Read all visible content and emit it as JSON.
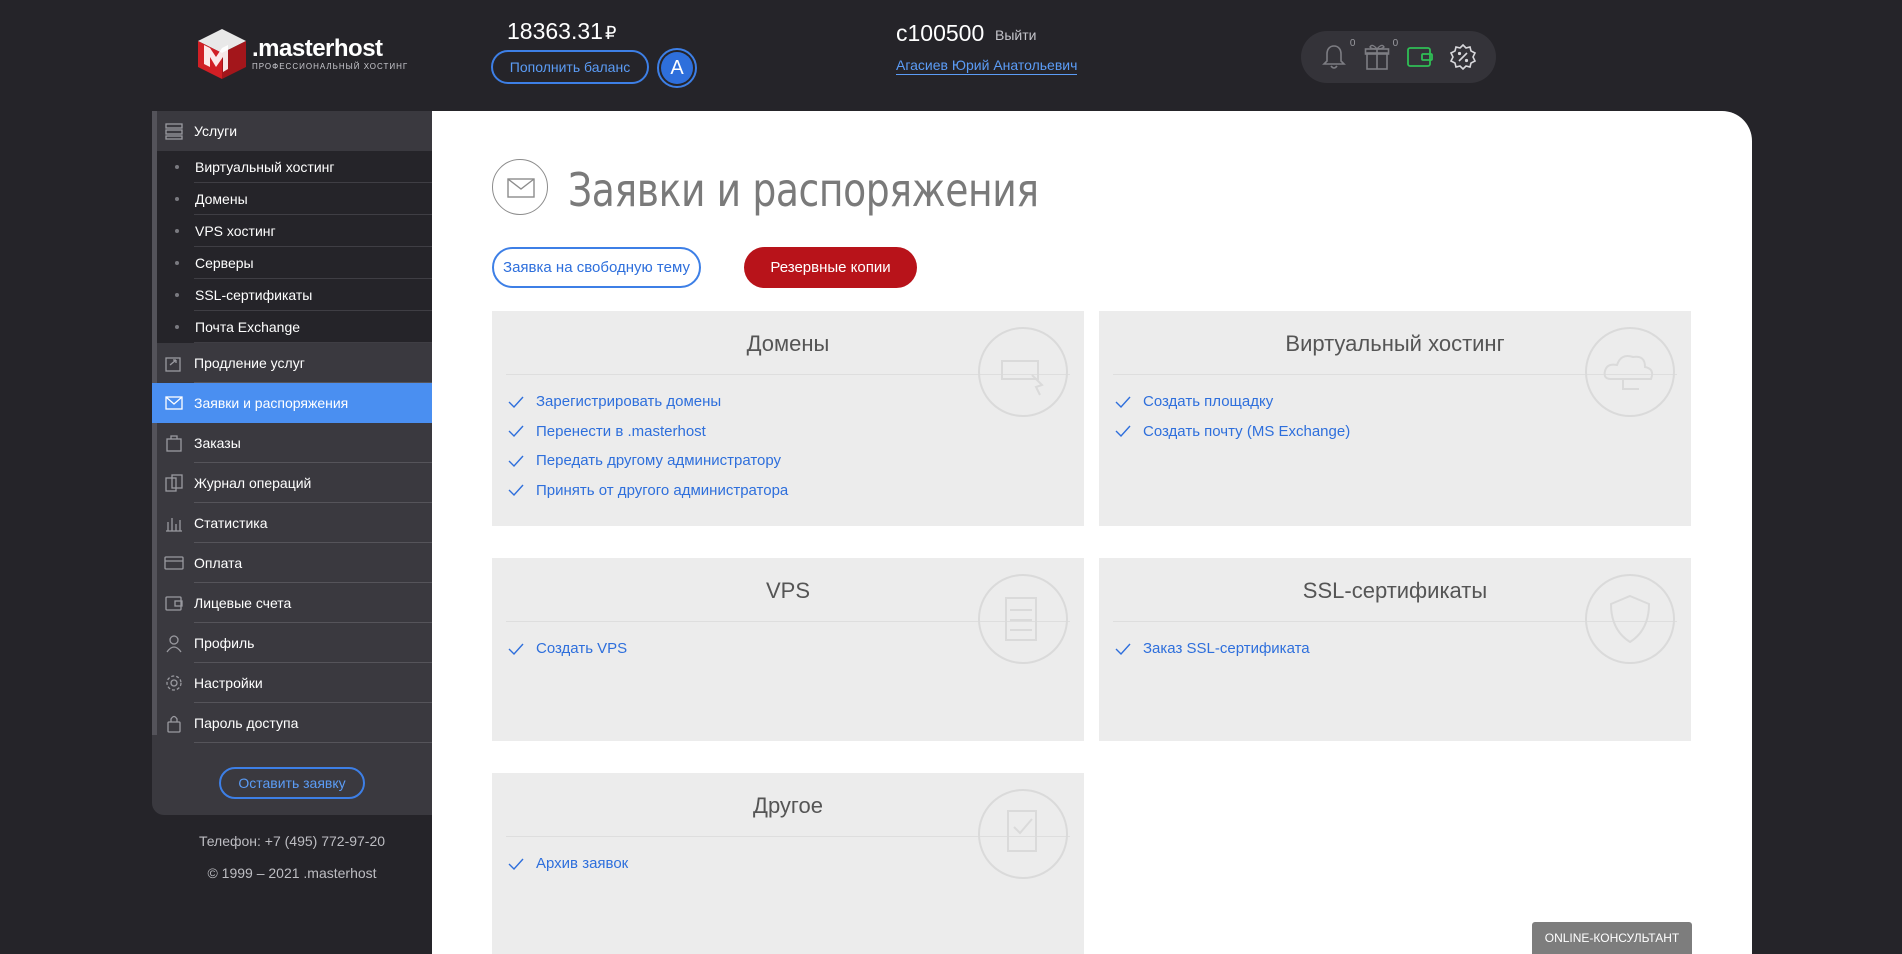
{
  "header": {
    "logo_name": ".masterhost",
    "logo_tagline": "профессиональный хостинг",
    "balance": "18363.31",
    "currency": "₽",
    "topup_label": "Пополнить баланс",
    "avatar_letter": "A",
    "account_id": "c100500",
    "logout_label": "Выйти",
    "user_name": "Агасиев Юрий Анатольевич",
    "notifications_count": "0",
    "gifts_count": "0"
  },
  "sidebar": {
    "services_label": "Услуги",
    "sub_items": [
      "Виртуальный хостинг",
      "Домены",
      "VPS хостинг",
      "Серверы",
      "SSL-сертификаты",
      "Почта Exchange"
    ],
    "items": [
      "Продление услуг",
      "Заявки и распоряжения",
      "Заказы",
      "Журнал операций",
      "Статистика",
      "Оплата",
      "Лицевые счета",
      "Профиль",
      "Настройки",
      "Пароль доступа"
    ],
    "leave_request": "Оставить заявку",
    "phone": "Телефон: +7 (495) 772-97-20",
    "copyright": "© 1999 – 2021 .masterhost"
  },
  "main": {
    "title": "Заявки и распоряжения",
    "btn_free": "Заявка на свободную тему",
    "btn_backup": "Резервные копии",
    "cards": [
      {
        "title": "Домены",
        "links": [
          "Зарегистрировать домены",
          "Перенести в .masterhost",
          "Передать другому администратору",
          "Принять от другого администратора"
        ]
      },
      {
        "title": "Виртуальный хостинг",
        "links": [
          "Создать площадку",
          "Создать почту (MS Exchange)"
        ]
      },
      {
        "title": "VPS",
        "links": [
          "Создать VPS"
        ]
      },
      {
        "title": "SSL-сертификаты",
        "links": [
          "Заказ SSL-сертификата"
        ]
      },
      {
        "title": "Другое",
        "links": [
          "Архив заявок"
        ]
      }
    ]
  },
  "online_consultant": "ONLINE-КОНСУЛЬТАНТ",
  "colors": {
    "background": "#252429",
    "sidebar": "#3a393f",
    "active": "#4a8ff1",
    "link": "#2e6fdc",
    "backup_button": "#b8131a"
  }
}
